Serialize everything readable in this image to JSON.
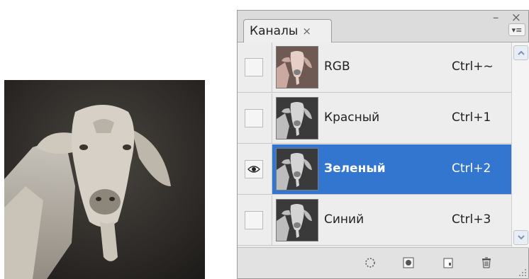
{
  "panel": {
    "tab_label": "Каналы",
    "tab_close": "×",
    "window_buttons": "– ×",
    "menu_glyph": "▾≡"
  },
  "channels": [
    {
      "name": "RGB",
      "shortcut": "Ctrl+~",
      "visible": false,
      "selected": false,
      "thumb": "color"
    },
    {
      "name": "Красный",
      "shortcut": "Ctrl+1",
      "visible": false,
      "selected": false,
      "thumb": "gray"
    },
    {
      "name": "Зеленый",
      "shortcut": "Ctrl+2",
      "visible": true,
      "selected": true,
      "thumb": "gray"
    },
    {
      "name": "Синий",
      "shortcut": "Ctrl+3",
      "visible": false,
      "selected": false,
      "thumb": "gray"
    }
  ],
  "footer": {
    "buttons": [
      "load-selection-icon",
      "save-selection-icon",
      "new-channel-icon",
      "delete-channel-icon"
    ]
  },
  "colors": {
    "selected_row": "#3376d0",
    "panel_bg": "#ececec"
  }
}
